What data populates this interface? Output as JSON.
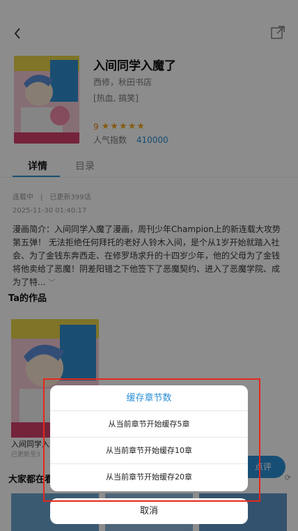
{
  "manga": {
    "title": "入间同学入魔了",
    "authors": "西修，秋田书店",
    "tags": "[热血, 搞笑]",
    "score": "9",
    "popularity_label": "人气指数",
    "popularity_value": "410000"
  },
  "tabs": [
    {
      "label": "详情"
    },
    {
      "label": "目录"
    }
  ],
  "detail": {
    "status_line": "连载中　|　已更新399话",
    "updated_at": "2025-11-30 01:40:17",
    "synopsis": "漫画简介：入间同学入魔了漫画，周刊少年Champion上的新连载大攻势第五弹！ 无法拒绝任何拜托的老好人铃木入间，是个从1岁开始就踏入社会、为了金钱东奔西走、在修罗场求升的十四岁少年，他的父母为了金钱将他卖给了恶魔！阴差阳错之下他签下了恶魔契约、进入了恶魔学院、成为了特..."
  },
  "works": {
    "heading": "Ta的作品",
    "items": [
      {
        "title": "入间同学入",
        "subtitle": "已更新至3"
      }
    ]
  },
  "review_button": {
    "label": "点评"
  },
  "everyone": {
    "heading": "大家都在看"
  },
  "dialog": {
    "title": "缓存章节数",
    "options": [
      {
        "label": "从当前章节开始缓存5章"
      },
      {
        "label": "从当前章节开始缓存10章"
      },
      {
        "label": "从当前章节开始缓存20章"
      }
    ],
    "cancel_label": "取消"
  },
  "colors": {
    "accent": "#2a8fd6",
    "star": "#f2a620",
    "highlight": "#e4281c"
  },
  "icons": [
    "back-arrow-icon",
    "share-icon",
    "star-icon",
    "chevron-down-icon",
    "refresh-icon"
  ]
}
